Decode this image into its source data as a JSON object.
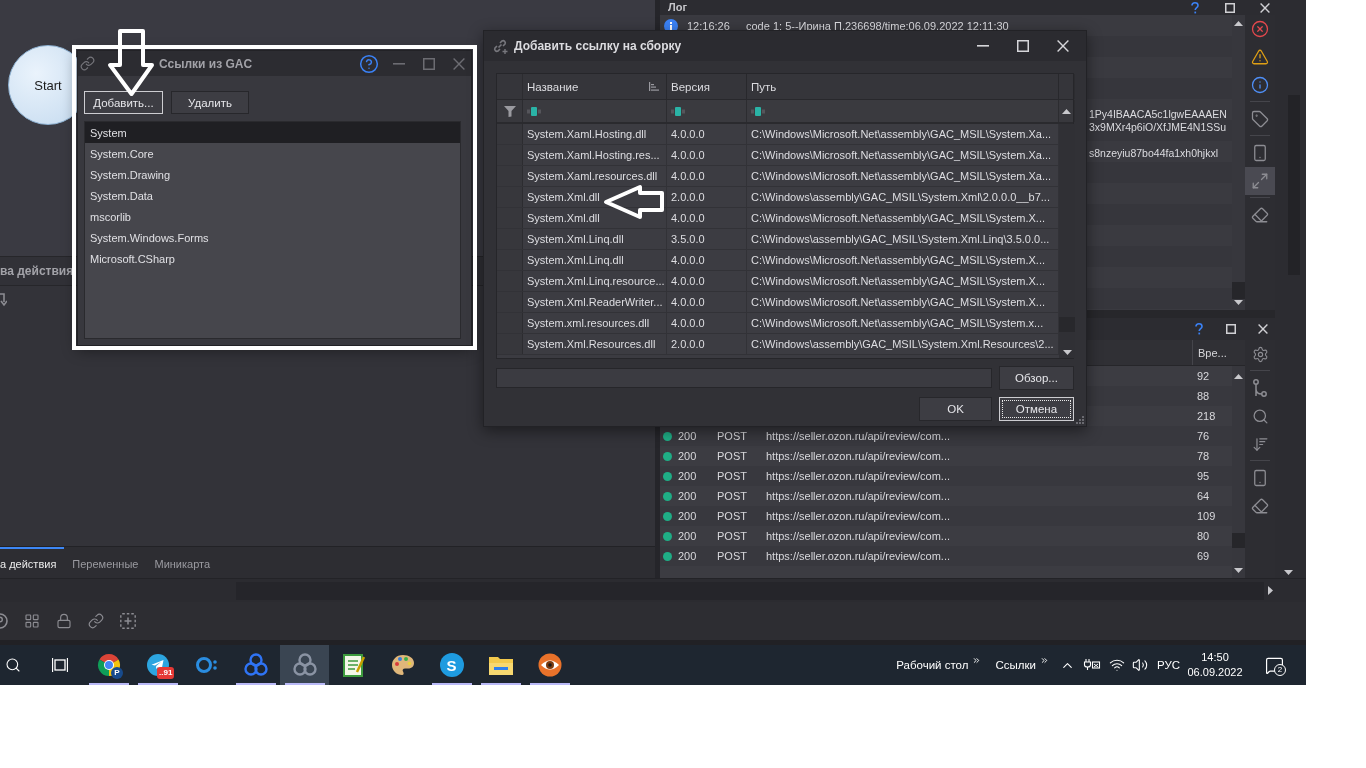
{
  "canvas": {
    "nodes": [
      {
        "label": "Start"
      }
    ]
  },
  "properties_panel": {
    "title": "ва действия"
  },
  "bottom_tabs": [
    {
      "label": "а действия",
      "selected": true
    },
    {
      "label": "Переменные",
      "selected": false
    },
    {
      "label": "Миникарта",
      "selected": false
    }
  ],
  "log_panel": {
    "title": "Лог",
    "entries": [
      {
        "kind": "info",
        "time": "12:16:26",
        "text": "code 1: 5--Ирина П.236698/time:06.09.2022 12:11:30"
      }
    ],
    "message_fragments": [
      {
        "lines": [
          "1Py4IBAACA5c1lgwEAAAEN",
          "3x9MXr4p6iO/XfJME4N1SSu"
        ]
      },
      {
        "lines": [
          "s8nzeyiu87bo44fa1xh0hjkxl"
        ]
      }
    ],
    "tool_groups": [
      {
        "tools": [
          {
            "kind": "error",
            "selected": false
          },
          {
            "kind": "warning",
            "selected": false
          },
          {
            "kind": "info",
            "selected": false
          }
        ]
      },
      {
        "tools": [
          {
            "kind": "tag",
            "selected": false
          }
        ]
      },
      {
        "tools": [
          {
            "kind": "scroll",
            "selected": false
          },
          {
            "kind": "expand",
            "selected": true
          }
        ]
      },
      {
        "tools": [
          {
            "kind": "clear",
            "selected": false
          }
        ]
      }
    ]
  },
  "network_panel": {
    "columns": [
      {
        "label": "Вре..."
      }
    ],
    "rows": [
      {
        "time": "92"
      },
      {
        "time": "88"
      },
      {
        "time": "218"
      },
      {
        "color": "#1fae86",
        "status": "200",
        "method": "POST",
        "url": "https://seller.ozon.ru/api/review/com...",
        "time": "76"
      },
      {
        "color": "#1fae86",
        "status": "200",
        "method": "POST",
        "url": "https://seller.ozon.ru/api/review/com...",
        "time": "78"
      },
      {
        "color": "#1fae86",
        "status": "200",
        "method": "POST",
        "url": "https://seller.ozon.ru/api/review/com...",
        "time": "95"
      },
      {
        "color": "#1fae86",
        "status": "200",
        "method": "POST",
        "url": "https://seller.ozon.ru/api/review/com...",
        "time": "64"
      },
      {
        "color": "#1fae86",
        "status": "200",
        "method": "POST",
        "url": "https://seller.ozon.ru/api/review/com...",
        "time": "109"
      },
      {
        "color": "#1fae86",
        "status": "200",
        "method": "POST",
        "url": "https://seller.ozon.ru/api/review/com...",
        "time": "80"
      },
      {
        "color": "#1fae86",
        "status": "200",
        "method": "POST",
        "url": "https://seller.ozon.ru/api/review/com...",
        "time": "69"
      }
    ]
  },
  "gac_dialog": {
    "title": "Ссылки из GAC",
    "buttons": [
      {
        "label": "Добавить...",
        "focused": true
      },
      {
        "label": "Удалить",
        "focused": false
      }
    ],
    "references": [
      {
        "name": "System",
        "selected": true
      },
      {
        "name": "System.Core",
        "selected": false
      },
      {
        "name": "System.Drawing",
        "selected": false
      },
      {
        "name": "System.Data",
        "selected": false
      },
      {
        "name": "mscorlib",
        "selected": false
      },
      {
        "name": "System.Windows.Forms",
        "selected": false
      },
      {
        "name": "Microsoft.CSharp",
        "selected": false
      }
    ]
  },
  "add_reference_dialog": {
    "title": "Добавить ссылку на сборку",
    "columns": [
      {
        "label": "Название",
        "sorted": true
      },
      {
        "label": "Версия",
        "sorted": false
      },
      {
        "label": "Путь",
        "sorted": false
      }
    ],
    "rows": [
      {
        "name": "System.Xaml.Hosting.dll",
        "version": "4.0.0.0",
        "path": "C:\\Windows\\Microsoft.Net\\assembly\\GAC_MSIL\\System.Xa..."
      },
      {
        "name": "System.Xaml.Hosting.res...",
        "version": "4.0.0.0",
        "path": "C:\\Windows\\Microsoft.Net\\assembly\\GAC_MSIL\\System.Xa..."
      },
      {
        "name": "System.Xaml.resources.dll",
        "version": "4.0.0.0",
        "path": "C:\\Windows\\Microsoft.Net\\assembly\\GAC_MSIL\\System.Xa..."
      },
      {
        "name": "System.Xml.dll",
        "version": "2.0.0.0",
        "path": "C:\\Windows\\assembly\\GAC_MSIL\\System.Xml\\2.0.0.0__b7..."
      },
      {
        "name": "System.Xml.dll",
        "version": "4.0.0.0",
        "path": "C:\\Windows\\Microsoft.Net\\assembly\\GAC_MSIL\\System.X..."
      },
      {
        "name": "System.Xml.Linq.dll",
        "version": "3.5.0.0",
        "path": "C:\\Windows\\assembly\\GAC_MSIL\\System.Xml.Linq\\3.5.0.0..."
      },
      {
        "name": "System.Xml.Linq.dll",
        "version": "4.0.0.0",
        "path": "C:\\Windows\\Microsoft.Net\\assembly\\GAC_MSIL\\System.X..."
      },
      {
        "name": "System.Xml.Linq.resource...",
        "version": "4.0.0.0",
        "path": "C:\\Windows\\Microsoft.Net\\assembly\\GAC_MSIL\\System.X..."
      },
      {
        "name": "System.Xml.ReaderWriter...",
        "version": "4.0.0.0",
        "path": "C:\\Windows\\Microsoft.Net\\assembly\\GAC_MSIL\\System.X..."
      },
      {
        "name": "System.xml.resources.dll",
        "version": "4.0.0.0",
        "path": "C:\\Windows\\Microsoft.Net\\assembly\\GAC_MSIL\\System.x..."
      },
      {
        "name": "System.Xml.Resources.dll",
        "version": "2.0.0.0",
        "path": "C:\\Windows\\assembly\\GAC_MSIL\\System.Xml.Resources\\2..."
      }
    ],
    "browse_button": {
      "label": "Обзор..."
    },
    "buttons": [
      {
        "label": "OK",
        "focused": false
      },
      {
        "label": "Отмена",
        "focused": true
      }
    ]
  },
  "taskbar": {
    "apps": [
      {
        "kind": "browser",
        "badge": "P",
        "running": true,
        "active": false
      },
      {
        "kind": "messenger",
        "badge": "..91",
        "running": true,
        "active": false
      },
      {
        "kind": "ring",
        "running": false,
        "active": false
      },
      {
        "kind": "knot",
        "running": true,
        "active": false
      },
      {
        "kind": "knot-grey",
        "running": true,
        "active": true
      },
      {
        "kind": "notepad",
        "running": false,
        "active": false
      },
      {
        "kind": "palette",
        "running": false,
        "active": false
      },
      {
        "kind": "letter",
        "letter": "S",
        "running": true,
        "active": false
      },
      {
        "kind": "folder",
        "running": true,
        "active": false
      },
      {
        "kind": "eye",
        "running": true,
        "active": false
      }
    ],
    "toolbars": [
      {
        "label": "Рабочий стол"
      },
      {
        "label": "Ссылки"
      }
    ],
    "language": "РУС",
    "time": "14:50",
    "date": "06.09.2022",
    "notification_count": "2"
  }
}
